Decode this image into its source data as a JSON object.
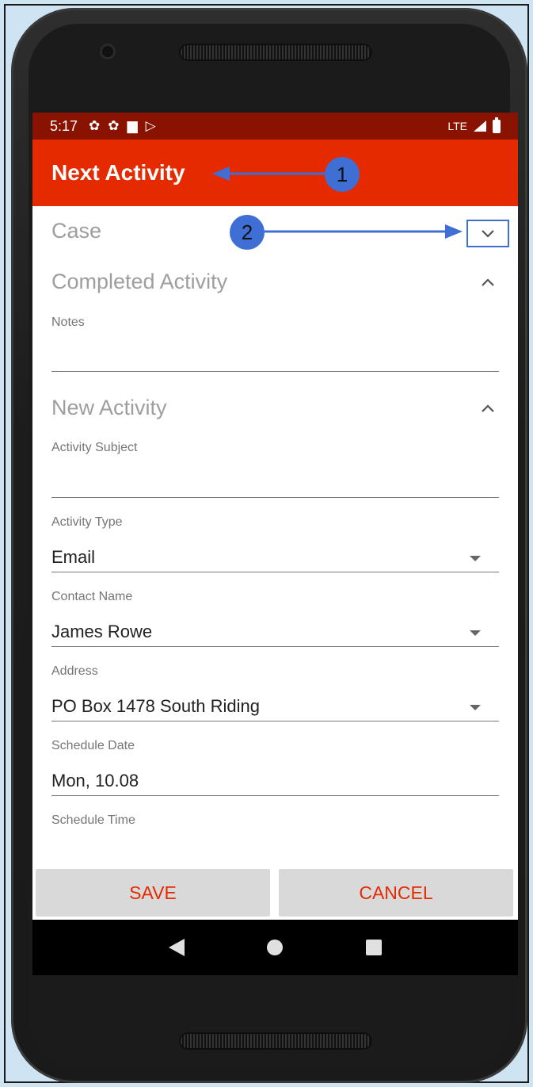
{
  "status_bar": {
    "time": "5:17",
    "network": "LTE"
  },
  "app_bar": {
    "title": "Next Activity"
  },
  "sections": {
    "case": "Case",
    "completed_activity": "Completed Activity",
    "new_activity": "New Activity"
  },
  "fields": {
    "notes_label": "Notes",
    "notes_value": "",
    "activity_subject_label": "Activity Subject",
    "activity_subject_value": "",
    "activity_type_label": "Activity Type",
    "activity_type_value": "Email",
    "contact_name_label": "Contact Name",
    "contact_name_value": "James Rowe",
    "address_label": "Address",
    "address_value": "PO Box 1478 South Riding",
    "schedule_date_label": "Schedule Date",
    "schedule_date_value": "Mon, 10.08",
    "schedule_time_label": "Schedule Time"
  },
  "buttons": {
    "save": "SAVE",
    "cancel": "CANCEL"
  },
  "callouts": {
    "one": "1",
    "two": "2"
  },
  "icons": {
    "chevron_down": "chevron-down-icon",
    "chevron_up": "chevron-up-icon",
    "dropdown": "dropdown-caret-icon",
    "nav_back": "back-triangle-icon",
    "nav_home": "home-circle-icon",
    "nav_recent": "recents-square-icon"
  },
  "colors": {
    "status_bar": "#8a1200",
    "app_bar": "#e52a00",
    "accent_text": "#e52a00",
    "annotation": "#3f6fd4"
  }
}
